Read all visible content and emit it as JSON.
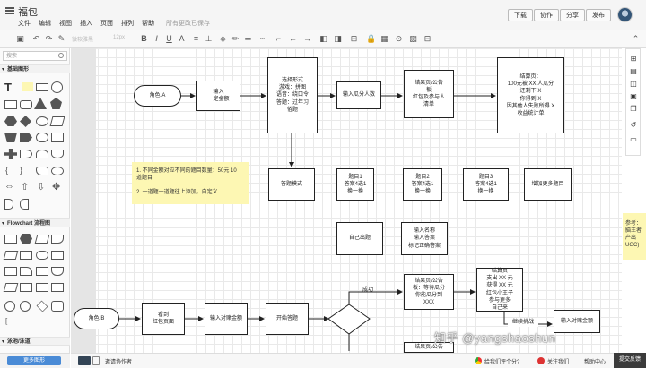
{
  "app": {
    "title": "福包",
    "menus": [
      "文件",
      "编辑",
      "视图",
      "插入",
      "页面",
      "排列",
      "帮助"
    ],
    "save_status": "所有更改已保存",
    "buttons": {
      "download": "下载",
      "collaborate": "协作",
      "share": "分享",
      "publish": "发布"
    }
  },
  "toolbar": {
    "font_name": "微软雅黑",
    "font_size": "12px"
  },
  "sidebar": {
    "search_placeholder": "搜索",
    "sections": {
      "basic": "基础图形",
      "flowchart": "Flowchart 流程图",
      "swimlane": "泳池/泳道"
    },
    "more_shapes": "更多图形"
  },
  "canvas": {
    "nodes": {
      "role_a": "角色 A",
      "input_amount": "输入\n一定金额",
      "choose_form": "选择形式\n游戏：拼图\n语音：绕口令\n答题：过年习\n俗题",
      "input_people": "输入瓜分人数",
      "result_page_1": "结果页/公告\n板\n红包及参与人\n清单",
      "settle_page_1": "结算页：\n100元被 XX 人瓜分\n还剩下 X\n你得到 X\n因其他人失败所得 X\n收益统计单",
      "answer_mode": "答题模式",
      "q1": "题目1\n答案4选1\n换一换",
      "q2": "题目2\n答案4选1\n换一换",
      "q3": "题目3\n答案4选1\n换一换",
      "add_more": "增加更多题目",
      "self_made": "自己出题",
      "input_name": "输入名称\n输入答案\n标记正确答案",
      "note": "1. 不同金额对应不同的题目数量：50元 10\n    道题目\n\n2. 一道题一道题往上添加，自定义",
      "side_note": "参考：\n脑王者\n产出\nUGC)",
      "role_b": "角色 B",
      "see_red_page": "看到\n红包页面",
      "input_bet": "输入对赌金额",
      "start_answer": "开始答题",
      "success": "成功",
      "result_page_2": "结果页/公告\n板：等待瓜分\n你能瓜分到\nXXX",
      "settle_page_2": "结算页\n支出 XX 元\n获得 XX 元\n红包小王子\n参与更多\n自己来",
      "continue_challenge": "继续挑战",
      "input_bet_2": "输入对赌金额",
      "result_page_3": "结果页/公告"
    },
    "watermark": "知乎 @yangshaoshun"
  },
  "bottom": {
    "invite": "邀请协作者",
    "rate": "给我们评个分?",
    "follow": "关注我们",
    "help": "帮助中心",
    "feedback": "提交反馈"
  },
  "colors": {
    "note_bg": "#fdf7b3",
    "more_btn": "#4a8bd6",
    "feedback_bg": "#3b3b3b"
  }
}
